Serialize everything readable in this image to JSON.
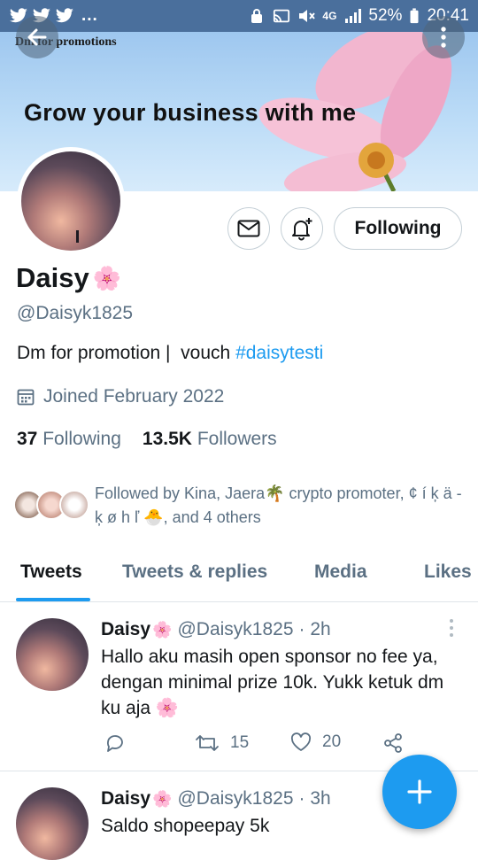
{
  "status_bar": {
    "notifications_more": "...",
    "network": "4G",
    "battery": "52%",
    "time": "20:41"
  },
  "banner": {
    "promo_small": "Dm for promotions",
    "tagline": "Grow your business with me"
  },
  "profile": {
    "name": "Daisy",
    "name_emoji": "🌸",
    "handle": "@Daisyk1825",
    "bio_text": "Dm for promotion |  vouch ",
    "bio_hashtag": "#daisytesti",
    "joined": "Joined February 2022",
    "following_count": "37",
    "following_label": "Following",
    "followers_count": "13.5K",
    "followers_label": "Followers",
    "followed_by": "Followed by Kina, Jaera🌴 crypto promoter, ¢ í ķ ä - ķ ø h ľ 🐣, and 4 others",
    "follow_button": "Following"
  },
  "tabs": [
    {
      "label": "Tweets",
      "active": true
    },
    {
      "label": "Tweets & replies",
      "active": false
    },
    {
      "label": "Media",
      "active": false
    },
    {
      "label": "Likes",
      "active": false
    }
  ],
  "tweets": [
    {
      "name": "Daisy",
      "emoji": "🌸",
      "handle": "@Daisyk1825",
      "time": "· 2h",
      "text": "Hallo aku masih open sponsor no fee ya, dengan minimal prize 10k. Yukk ketuk dm ku aja 🌸",
      "retweets": "15",
      "likes": "20"
    },
    {
      "name": "Daisy",
      "emoji": "🌸",
      "handle": "@Daisyk1825",
      "time": "· 3h",
      "text": "Saldo shopeepay 5k"
    }
  ],
  "colors": {
    "accent": "#1d9bf0",
    "status_bar": "#4a6f9c",
    "secondary_text": "#5b7083"
  }
}
